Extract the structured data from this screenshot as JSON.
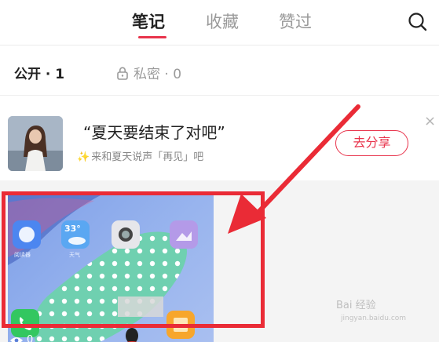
{
  "tabs": {
    "notes": "笔记",
    "collect": "收藏",
    "liked": "赞过"
  },
  "filters": {
    "public": "公开 · 1",
    "private": "私密 · 0"
  },
  "banner": {
    "title": "“夏天要结束了对吧”",
    "subtitle": "来和夏天说声「再见」吧",
    "share_button": "去分享",
    "close": "×"
  },
  "note_card": {
    "app_labels": [
      "阅读器",
      "天气",
      "",
      "",
      "",
      ""
    ],
    "weather_temp": "33°",
    "view_count": "0"
  },
  "watermark": {
    "text": "Bai 经验",
    "sub": "jingyan.baidu.com"
  },
  "colors": {
    "accent": "#e8344c",
    "annotation": "#ea2b36"
  }
}
